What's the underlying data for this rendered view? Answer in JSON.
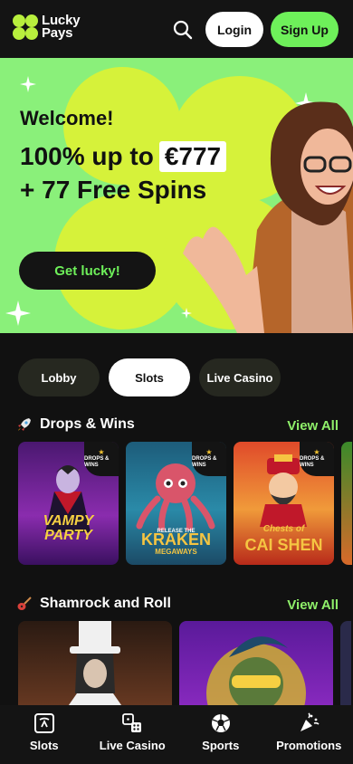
{
  "header": {
    "logo_line1": "Lucky",
    "logo_line2": "Pays",
    "login_label": "Login",
    "signup_label": "Sign Up"
  },
  "hero": {
    "welcome": "Welcome!",
    "offer_prefix": "100% up to",
    "offer_amount": "€777",
    "offer_line2": "+ 77 Free Spins",
    "cta_label": "Get lucky!"
  },
  "tabs": [
    {
      "label": "Lobby",
      "active": false
    },
    {
      "label": "Slots",
      "active": true
    },
    {
      "label": "Live Casino",
      "active": false
    }
  ],
  "sections": [
    {
      "title": "Drops & Wins",
      "view_all": "View All",
      "games": [
        {
          "title": "VAMPY PARTY",
          "badge": "DROPS & WINS"
        },
        {
          "title": "KRAKEN",
          "subtitle": "MEGAWAYS",
          "prefix": "RELEASE THE",
          "badge": "DROPS & WINS"
        },
        {
          "title": "CAI SHEN",
          "prefix": "Chests of",
          "badge": "DROPS & WINS"
        }
      ]
    },
    {
      "title": "Shamrock and Roll",
      "view_all": "View All"
    }
  ],
  "bottom_nav": [
    {
      "label": "Slots",
      "icon": "slot-machine-icon"
    },
    {
      "label": "Live Casino",
      "icon": "dice-icon"
    },
    {
      "label": "Sports",
      "icon": "soccer-ball-icon"
    },
    {
      "label": "Promotions",
      "icon": "party-popper-icon"
    }
  ],
  "colors": {
    "accent_green": "#6ef05a",
    "view_all_green": "#8ff06a",
    "hero_bg": "#8af07a",
    "hero_blob": "#d6f23a",
    "logo_green": "#b8ef3d",
    "background": "#111111"
  }
}
